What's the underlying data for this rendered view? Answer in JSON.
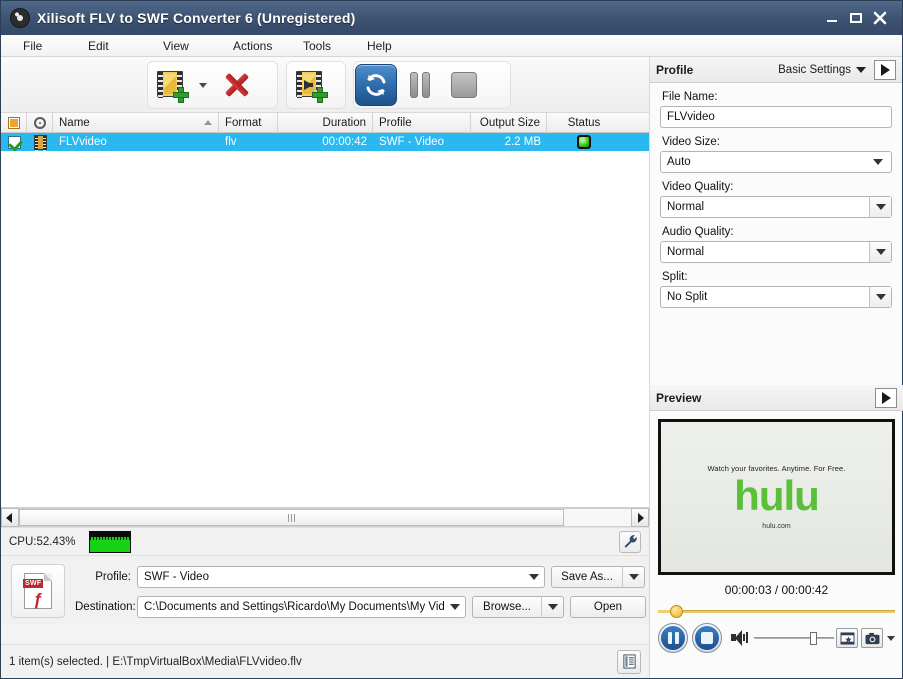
{
  "window": {
    "title": "Xilisoft FLV to SWF Converter 6 (Unregistered)",
    "app_icon": "film-reel-icon",
    "minimize_label": "minimize-icon",
    "maximize_label": "maximize-icon",
    "close_label": "close-icon",
    "titlebar_color": "#3c5270"
  },
  "menu": {
    "items": [
      {
        "label": "File"
      },
      {
        "label": "Edit"
      },
      {
        "label": "View"
      },
      {
        "label": "Actions"
      },
      {
        "label": "Tools"
      },
      {
        "label": "Help"
      }
    ]
  },
  "toolbar": {
    "add_file": "add-file-icon",
    "add_file_dropdown": "dropdown-arrow-icon",
    "remove": "remove-icon",
    "add_to_queue": "add-to-queue-icon",
    "convert": "convert-icon",
    "pause": "pause-icon",
    "stop": "stop-icon"
  },
  "file_list": {
    "columns": [
      {
        "label": "",
        "key": "check"
      },
      {
        "label": "",
        "key": "disc"
      },
      {
        "label": "Name",
        "key": "name"
      },
      {
        "label": "Format",
        "key": "format"
      },
      {
        "label": "Duration",
        "key": "duration"
      },
      {
        "label": "Profile",
        "key": "profile"
      },
      {
        "label": "Output Size",
        "key": "size"
      },
      {
        "label": "Status",
        "key": "status"
      }
    ],
    "rows": [
      {
        "checked": true,
        "name": "FLVvideo",
        "format": "flv",
        "duration": "00:00:42",
        "profile": "SWF - Video",
        "size": "2.2 MB",
        "status": "ready-green"
      }
    ]
  },
  "cpu": {
    "label": "CPU:52.43%",
    "settings_icon": "wrench-icon",
    "graph_color": "#17d117"
  },
  "bottom_profile": {
    "file_icon": "swf-file-icon",
    "profile_label": "Profile:",
    "profile_value": "SWF - Video",
    "save_as_label": "Save As...",
    "destination_label": "Destination:",
    "destination_value": "C:\\Documents and Settings\\Ricardo\\My Documents\\My Videos",
    "browse_label": "Browse...",
    "open_label": "Open"
  },
  "status_bar": {
    "text": "1 item(s) selected. | E:\\TmpVirtualBox\\Media\\FLVvideo.flv",
    "log_icon": "log-list-icon"
  },
  "profile_panel": {
    "title": "Profile",
    "settings_mode": "Basic Settings",
    "expand_icon": "expand-arrow-icon",
    "fields": [
      {
        "label": "File Name:",
        "value": "FLVvideo",
        "type": "text"
      },
      {
        "label": "Video Size:",
        "value": "Auto",
        "type": "select-full"
      },
      {
        "label": "Video Quality:",
        "value": "Normal",
        "type": "select"
      },
      {
        "label": "Audio Quality:",
        "value": "Normal",
        "type": "select"
      },
      {
        "label": "Split:",
        "value": "No Split",
        "type": "select"
      }
    ]
  },
  "preview": {
    "title": "Preview",
    "expand_icon": "expand-arrow-icon",
    "video": {
      "tagline": "Watch your favorites.  Anytime. For Free.",
      "logo": "hulu",
      "url": "hulu.com",
      "logo_color": "#5cbf38"
    },
    "time": "00:00:03 / 00:00:42",
    "controls": {
      "pause": "pause-icon",
      "stop": "stop-icon",
      "volume": "speaker-icon",
      "capture_clip": "capture-clip-icon",
      "snapshot": "camera-icon",
      "snapshot_dropdown": "dropdown-arrow-icon"
    }
  }
}
